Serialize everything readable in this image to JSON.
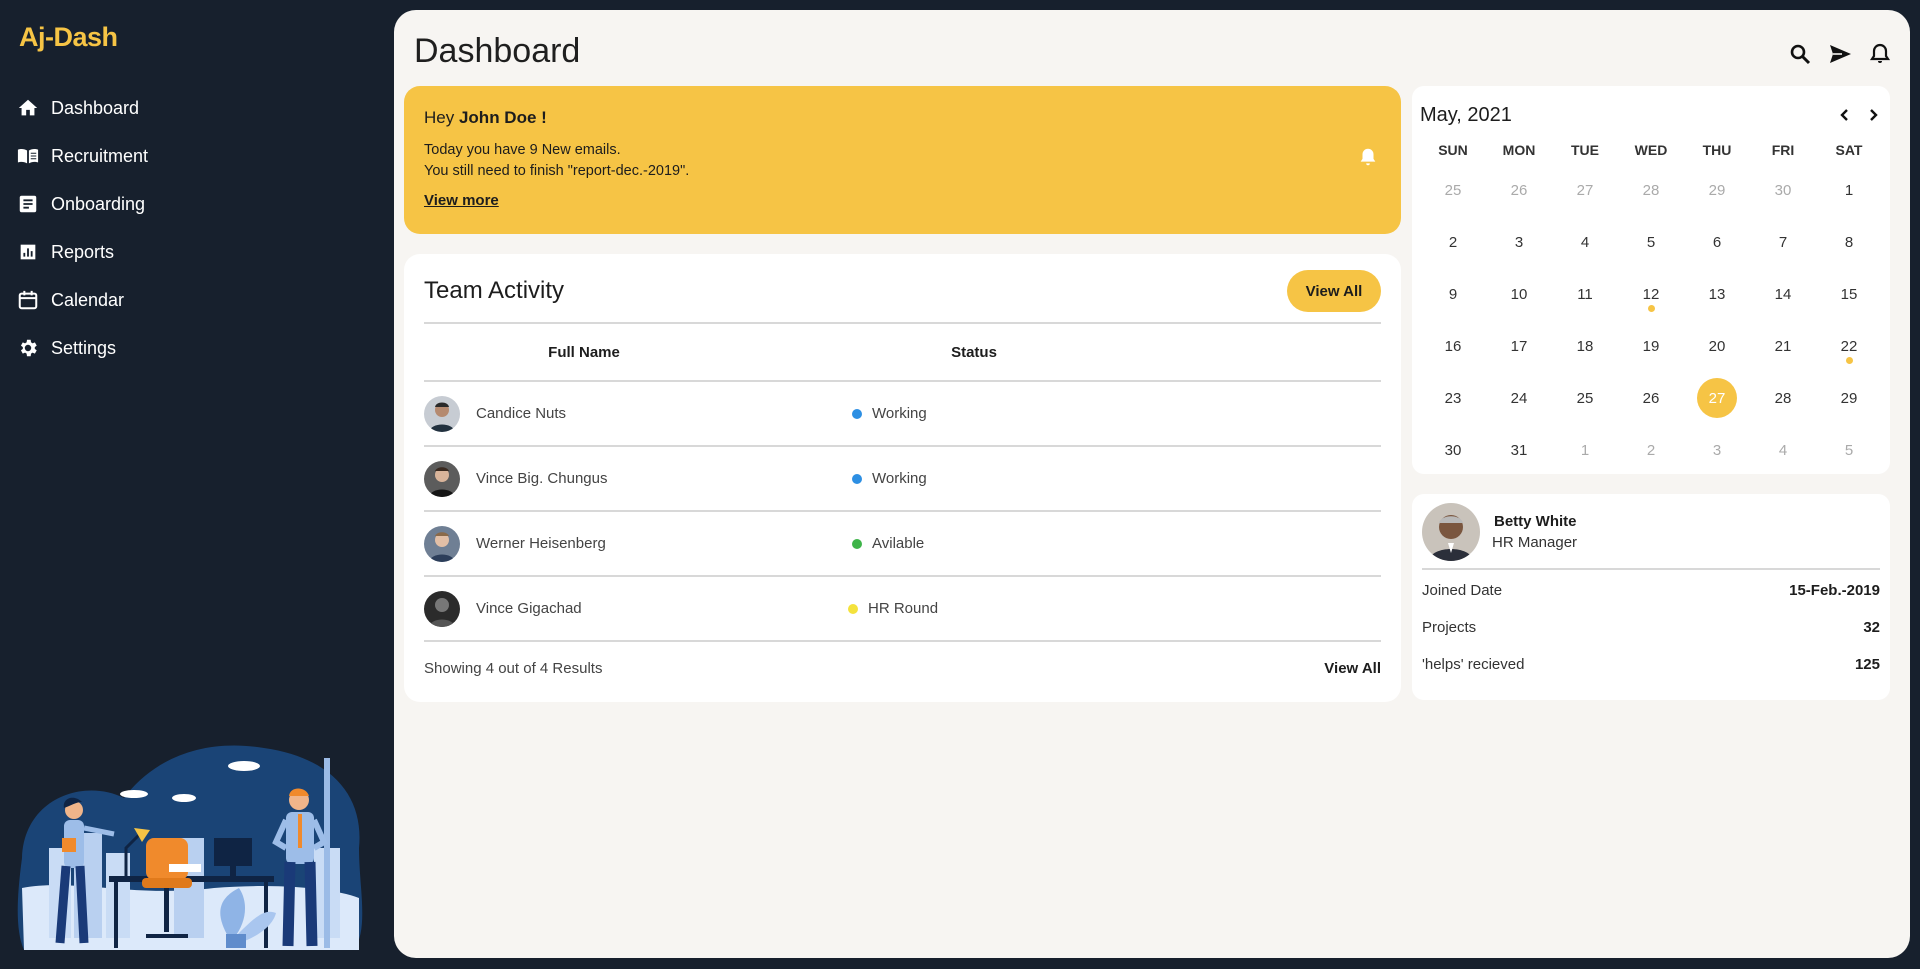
{
  "app": {
    "logo": "Aj-Dash"
  },
  "sidebar": {
    "items": [
      {
        "label": "Dashboard",
        "icon": "home-icon"
      },
      {
        "label": "Recruitment",
        "icon": "book-icon"
      },
      {
        "label": "Onboarding",
        "icon": "document-icon"
      },
      {
        "label": "Reports",
        "icon": "bar-chart-icon"
      },
      {
        "label": "Calendar",
        "icon": "calendar-icon"
      },
      {
        "label": "Settings",
        "icon": "gear-icon"
      }
    ]
  },
  "header": {
    "title": "Dashboard",
    "icons": [
      "search-icon",
      "send-icon",
      "bell-icon"
    ]
  },
  "alert": {
    "greeting": "Hey ",
    "user": "John Doe !",
    "line1": "Today you have 9 New emails.",
    "line2": "You still need to finish \"report-dec.-2019\".",
    "link": "View more"
  },
  "team": {
    "title": "Team Activity",
    "view_all_button": "View All",
    "columns": [
      "Full Name",
      "Status"
    ],
    "rows": [
      {
        "name": "Candice Nuts",
        "status": "Working",
        "status_color": "#2d8fe3"
      },
      {
        "name": "Vince Big. Chungus",
        "status": "Working",
        "status_color": "#2d8fe3"
      },
      {
        "name": "Werner Heisenberg",
        "status": "Avilable",
        "status_color": "#3eb449"
      },
      {
        "name": "Vince Gigachad",
        "status": "HR Round",
        "status_color": "#f4e23c"
      }
    ],
    "footer_text": "Showing 4 out of 4 Results",
    "footer_link": "View All"
  },
  "calendar": {
    "month": "May, 2021",
    "weekdays": [
      "SUN",
      "MON",
      "TUE",
      "WED",
      "THU",
      "FRI",
      "SAT"
    ],
    "days": [
      [
        "25",
        "26",
        "27",
        "28",
        "29",
        "30",
        "1"
      ],
      [
        "2",
        "3",
        "4",
        "5",
        "6",
        "7",
        "8"
      ],
      [
        "9",
        "10",
        "11",
        "12",
        "13",
        "14",
        "15"
      ],
      [
        "16",
        "17",
        "18",
        "19",
        "20",
        "21",
        "22"
      ],
      [
        "23",
        "24",
        "25",
        "26",
        "27",
        "28",
        "29"
      ],
      [
        "30",
        "31",
        "1",
        "2",
        "3",
        "4",
        "5"
      ]
    ],
    "today": "27",
    "event_days": [
      "12",
      "22"
    ]
  },
  "profile": {
    "name": "Betty White",
    "role": "HR Manager",
    "stats": [
      {
        "label": "Joined Date",
        "value": "15-Feb.-2019"
      },
      {
        "label": "Projects",
        "value": "32"
      },
      {
        "label": "'helps' recieved",
        "value": "125"
      }
    ]
  },
  "colors": {
    "accent": "#f6c445",
    "sidebar_bg": "#17202d",
    "main_bg": "#f7f5f2"
  }
}
